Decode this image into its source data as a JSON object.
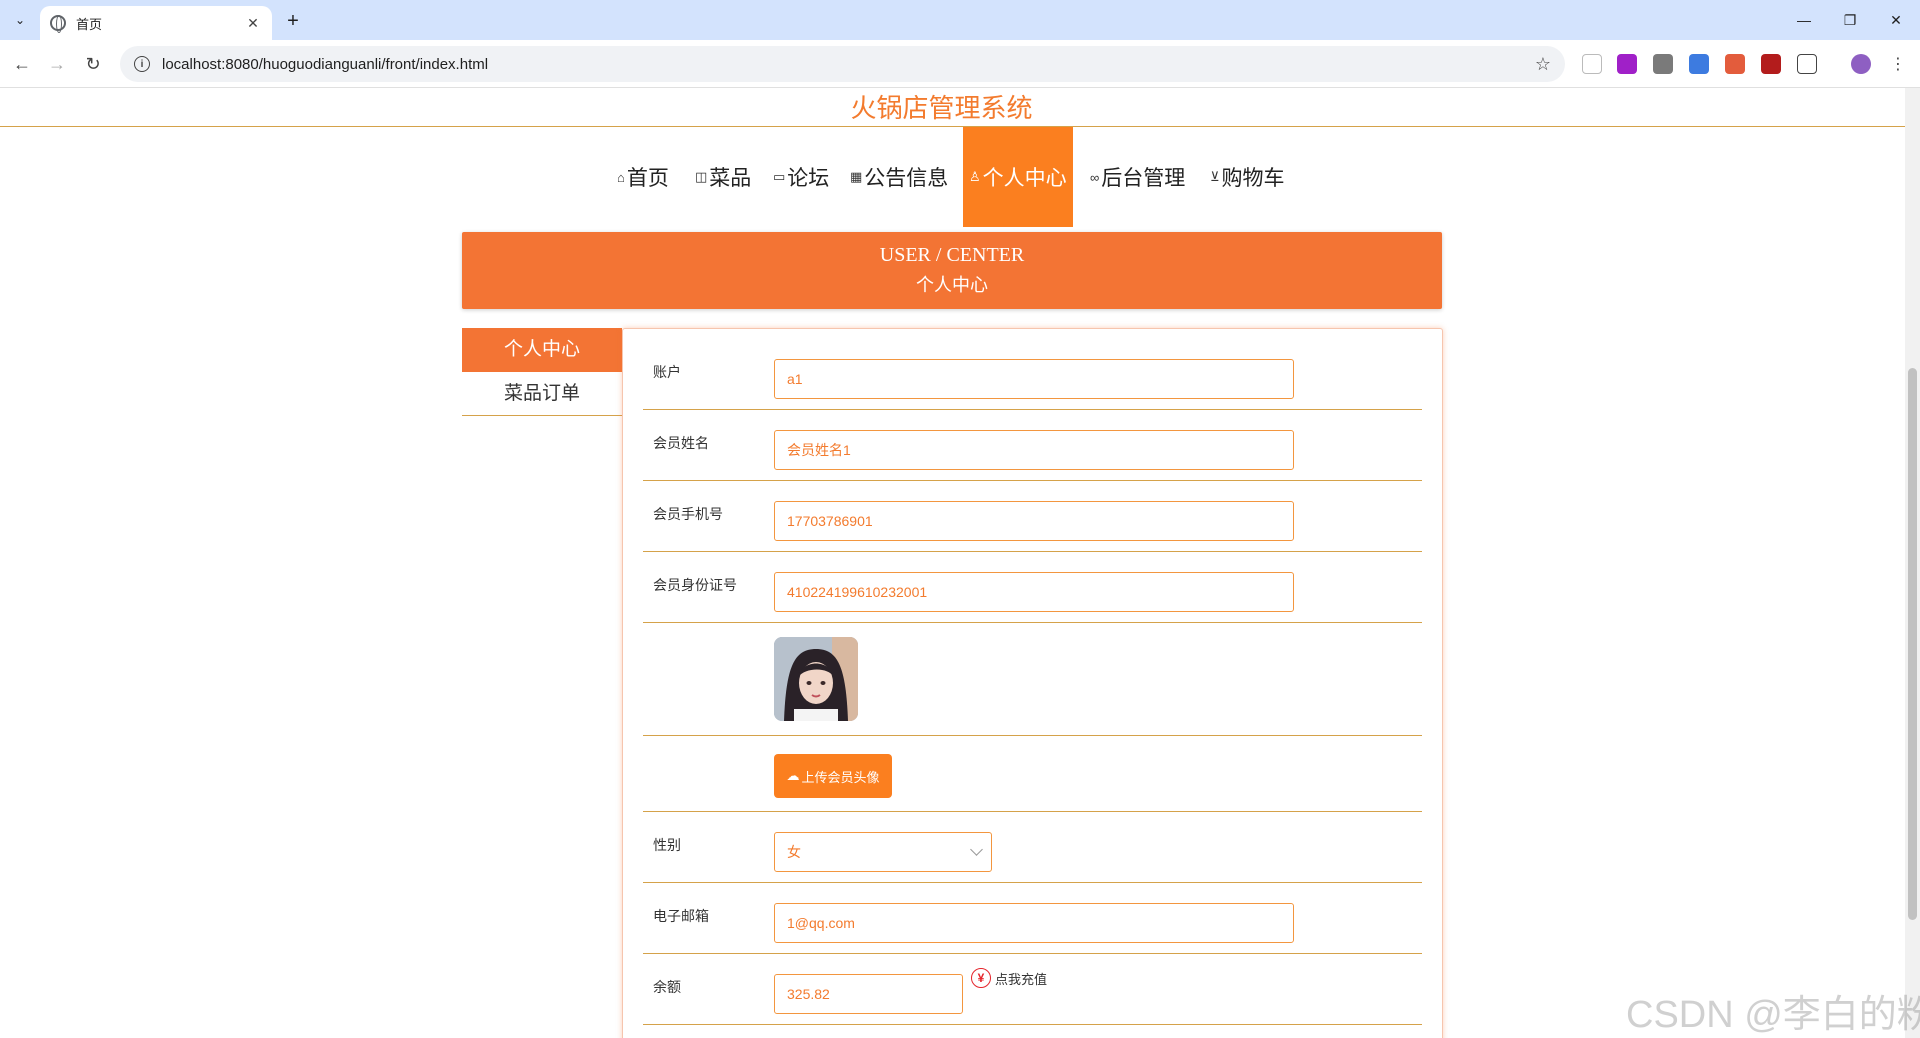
{
  "browser": {
    "tab_title": "首页",
    "url": "localhost:8080/huoguodianguanli/front/index.html"
  },
  "site": {
    "title": "火锅店管理系统",
    "nav": [
      {
        "label": "首页",
        "icon": "home-icon"
      },
      {
        "label": "菜品",
        "icon": "dish-icon"
      },
      {
        "label": "论坛",
        "icon": "forum-icon"
      },
      {
        "label": "公告信息",
        "icon": "notice-icon"
      },
      {
        "label": "个人中心",
        "icon": "user-icon",
        "active": true
      },
      {
        "label": "后台管理",
        "icon": "link-icon"
      },
      {
        "label": "购物车",
        "icon": "cart-icon"
      }
    ]
  },
  "banner": {
    "en": "USER / CENTER",
    "zh": "个人中心"
  },
  "sidebar": {
    "items": [
      {
        "label": "个人中心",
        "active": true
      },
      {
        "label": "菜品订单",
        "active": false
      }
    ]
  },
  "form": {
    "account_label": "账户",
    "account_value": "a1",
    "name_label": "会员姓名",
    "name_value": "会员姓名1",
    "phone_label": "会员手机号",
    "phone_value": "17703786901",
    "idcard_label": "会员身份证号",
    "idcard_value": "410224199610232001",
    "upload_label": "上传会员头像",
    "gender_label": "性别",
    "gender_value": "女",
    "email_label": "电子邮箱",
    "email_value": "1@qq.com",
    "balance_label": "余额",
    "balance_value": "325.82",
    "recharge_label": "点我充值"
  },
  "watermark": "CSDN @李白的粉",
  "colors": {
    "accent": "#f37434",
    "nav_active": "#fb7f1f",
    "divider": "#d5a24a",
    "input_text": "#f37b2e"
  }
}
